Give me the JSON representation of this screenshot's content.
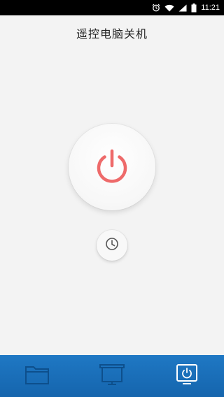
{
  "status_bar": {
    "time": "11:21",
    "icons": [
      "alarm-icon",
      "wifi-icon",
      "signal-icon",
      "battery-icon"
    ]
  },
  "page": {
    "title": "遥控电脑关机"
  },
  "controls": {
    "power_icon": "power-icon",
    "timer_icon": "clock-icon"
  },
  "bottom_nav": {
    "items": [
      {
        "icon": "folder-icon",
        "active": false
      },
      {
        "icon": "monitor-icon",
        "active": false
      },
      {
        "icon": "power-monitor-icon",
        "active": true
      }
    ]
  },
  "colors": {
    "power_accent": "#ee6a6a",
    "nav_background": "#1a6db8",
    "nav_inactive_icon": "#0d4f8c",
    "nav_active_icon": "#ffffff"
  }
}
